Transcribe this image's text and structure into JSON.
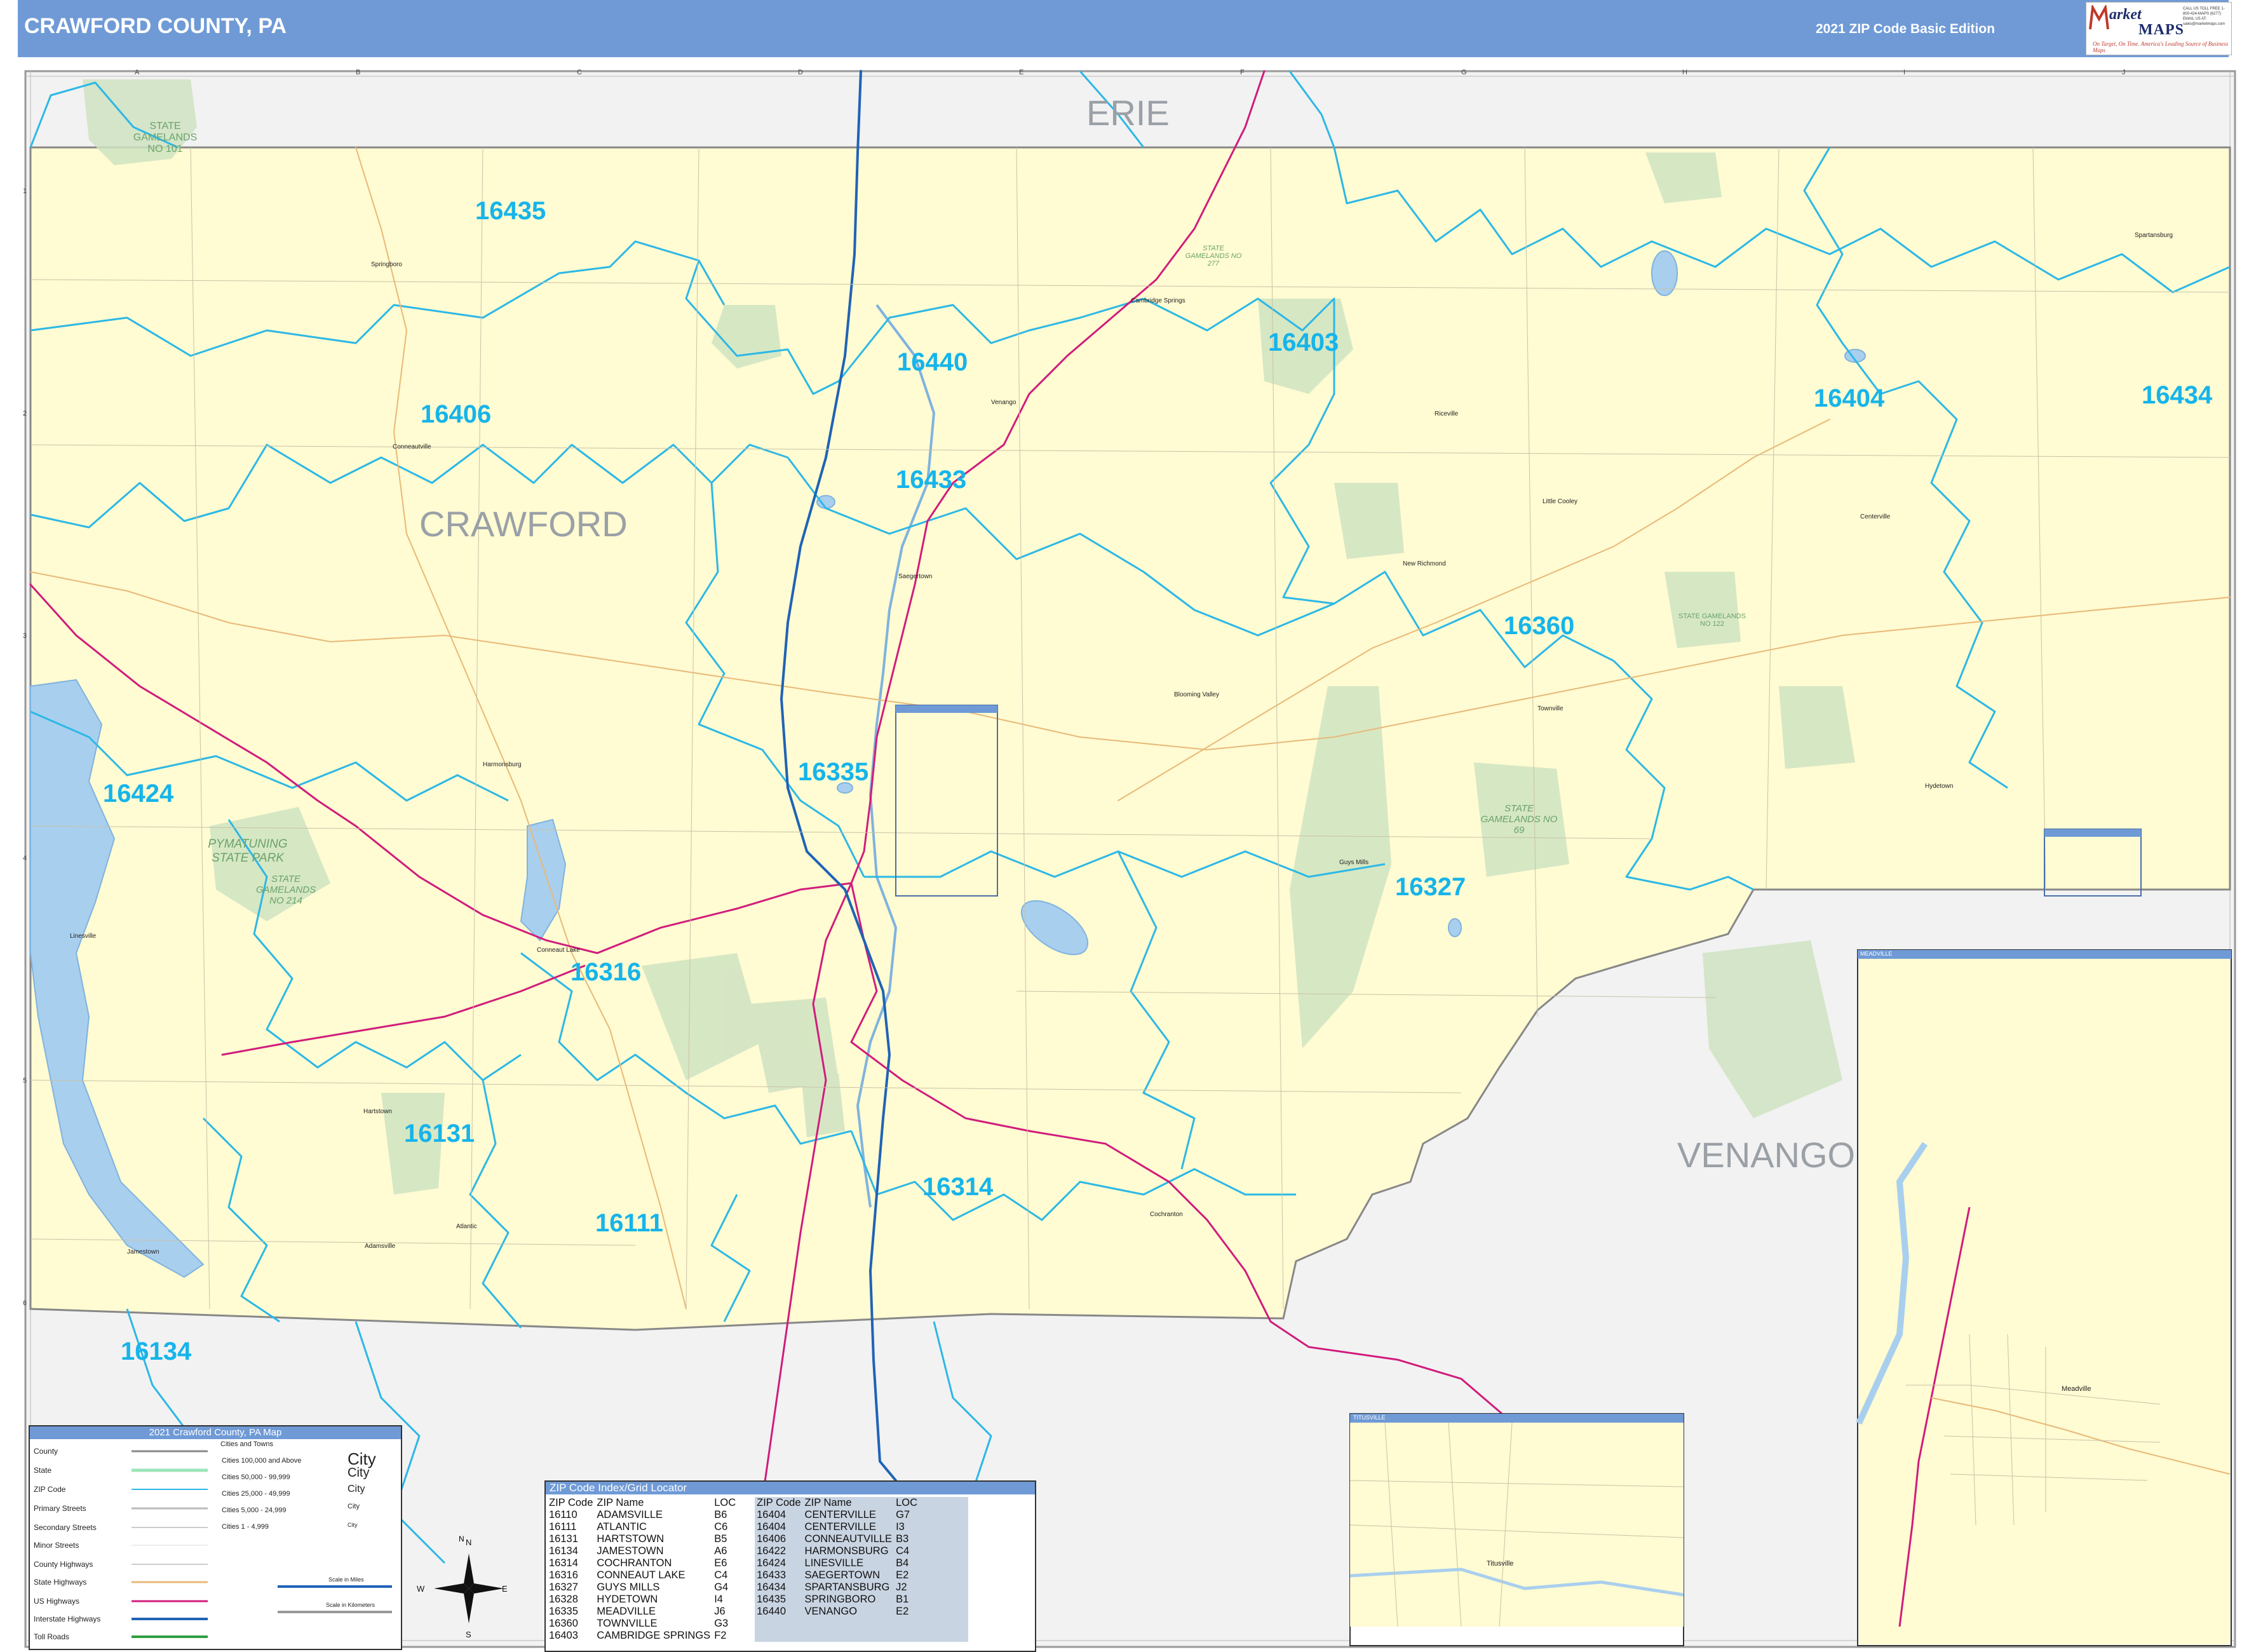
{
  "header": {
    "title": "CRAWFORD COUNTY, PA",
    "edition": "2021 ZIP Code Basic Edition",
    "logo_word1": "arket",
    "logo_word2": "MAPS",
    "logo_tagline": "On Target, On Time. America's Leading Source of Business Maps",
    "logo_contact": "CALL US TOLL FREE 1-800-424-MAPS (6277) EMAIL US AT: sales@marketmaps.com"
  },
  "grid": {
    "columns": [
      "A",
      "B",
      "C",
      "D",
      "E",
      "F",
      "G",
      "H",
      "I",
      "J"
    ],
    "rows": [
      "1",
      "2",
      "3",
      "4",
      "5",
      "6"
    ]
  },
  "places": {
    "neighbor_counties": [
      "ERIE",
      "VENANGO"
    ],
    "county_label": "CRAWFORD",
    "zip_labels": [
      "16435",
      "16406",
      "16440",
      "16433",
      "16403",
      "16404",
      "16434",
      "16360",
      "16335",
      "16424",
      "16327",
      "16316",
      "16131",
      "16314",
      "16111",
      "16134"
    ],
    "towns": [
      "Conneautville",
      "Linesville",
      "Conneaut Lake",
      "Saegertown",
      "Venango",
      "Cambridge Springs",
      "Townville",
      "Guys Mills",
      "Cochranton",
      "Spartansburg",
      "Centerville",
      "Hydetown",
      "Springboro",
      "Harmonsburg",
      "Atlantic",
      "Adamsville",
      "Jamestown",
      "Hartstown",
      "Blooming Valley",
      "Riceville",
      "Little Cooley",
      "New Richmond",
      "Titusville",
      "Meadville"
    ],
    "parks": [
      "STATE GAMELANDS NO 101",
      "PYMATUNING STATE PARK",
      "STATE GAMELANDS NO 214",
      "STATE GAMELANDS NO 69",
      "STATE GAMELANDS NO 122",
      "STATE GAMELANDS NO 277"
    ]
  },
  "insets": {
    "meadville_label": "MEADVILLE",
    "titusville_label": "TITUSVILLE"
  },
  "legend": {
    "title": "2021 Crawford County, PA Map",
    "items": [
      "County",
      "State",
      "ZIP Code",
      "Primary Streets",
      "Secondary Streets",
      "Minor Streets",
      "County Highways",
      "State Highways",
      "US Highways",
      "Interstate Highways",
      "Toll Roads"
    ],
    "cities_header": "Cities and Towns",
    "city_sizes": [
      "Cities 100,000 and Above",
      "Cities 50,000 - 99,999",
      "Cities 25,000 - 49,999",
      "Cities 5,000 - 24,999",
      "Cities 1 - 4,999"
    ],
    "city_samples": [
      "City",
      "City",
      "City",
      "City",
      "City"
    ],
    "scale_miles": "Scale in Miles",
    "scale_km": "Scale in Kilometers",
    "compass": [
      "N",
      "E",
      "S",
      "W"
    ]
  },
  "zip_index": {
    "title": "ZIP Code Index/Grid Locator",
    "headers": [
      "ZIP Code",
      "ZIP Name",
      "LOC",
      "ZIP Code",
      "ZIP Name",
      "LOC"
    ],
    "left": [
      [
        "16110",
        "ADAMSVILLE",
        "B6"
      ],
      [
        "16111",
        "ATLANTIC",
        "C6"
      ],
      [
        "16131",
        "HARTSTOWN",
        "B5"
      ],
      [
        "16134",
        "JAMESTOWN",
        "A6"
      ],
      [
        "16314",
        "COCHRANTON",
        "E6"
      ],
      [
        "16316",
        "CONNEAUT LAKE",
        "C4"
      ],
      [
        "16327",
        "GUYS MILLS",
        "G4"
      ],
      [
        "16328",
        "HYDETOWN",
        "I4"
      ],
      [
        "16335",
        "MEADVILLE",
        "J6"
      ],
      [
        "16360",
        "TOWNVILLE",
        "G3"
      ],
      [
        "16403",
        "CAMBRIDGE SPRINGS",
        "F2"
      ]
    ],
    "right": [
      [
        "16404",
        "CENTERVILLE",
        "G7"
      ],
      [
        "16404",
        "CENTERVILLE",
        "I3"
      ],
      [
        "16406",
        "CONNEAUTVILLE",
        "B3"
      ],
      [
        "16422",
        "HARMONSBURG",
        "C4"
      ],
      [
        "16424",
        "LINESVILLE",
        "B4"
      ],
      [
        "16433",
        "SAEGERTOWN",
        "E2"
      ],
      [
        "16434",
        "SPARTANSBURG",
        "J2"
      ],
      [
        "16435",
        "SPRINGBORO",
        "B1"
      ],
      [
        "16440",
        "VENANGO",
        "E2"
      ]
    ]
  },
  "colors": {
    "county_fill": "#fffbd2",
    "outside_fill": "#f0f0f0",
    "zip_boundary": "#2cb8e6",
    "zip_label": "#16b4ea",
    "us_highway": "#d11c7c",
    "interstate": "#1f63b6",
    "state_highway": "#e39a3a",
    "water": "#a9cfee",
    "gamelands": "#cfe3c2",
    "header": "#6f9ad6"
  }
}
